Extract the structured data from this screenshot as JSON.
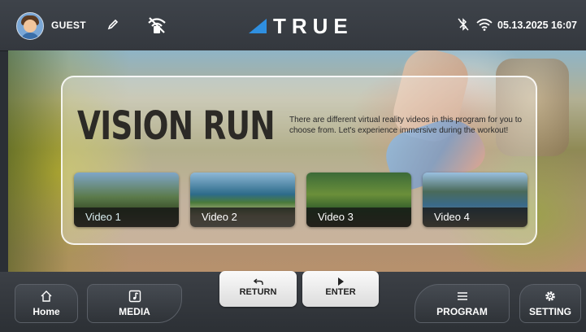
{
  "header": {
    "user_name": "GUEST",
    "brand": "TRUE",
    "datetime": "05.13.2025 16:07"
  },
  "hero": {
    "title": "VISION RUN",
    "description": "There are different virtual reality videos in this program for you to choose from. Let's experience immersive during the workout!",
    "videos": [
      {
        "label": "Video 1"
      },
      {
        "label": "Video 2"
      },
      {
        "label": "Video 3"
      },
      {
        "label": "Video 4"
      }
    ]
  },
  "footer": {
    "home_label": "Home",
    "media_label": "MEDIA",
    "return_label": "RETURN",
    "enter_label": "ENTER",
    "program_label": "PROGRAM",
    "setting_label": "SETTING"
  },
  "colors": {
    "bar_bg": "#3e434a",
    "brand_accent": "#2f8fe0",
    "button_light": "#fafafa"
  },
  "icons": [
    "avatar",
    "pencil-icon",
    "no-wifi-icon",
    "bluetooth-off-icon",
    "wifi-icon",
    "home-icon",
    "media-icon",
    "return-icon",
    "play-icon",
    "list-icon",
    "gear-icon"
  ]
}
